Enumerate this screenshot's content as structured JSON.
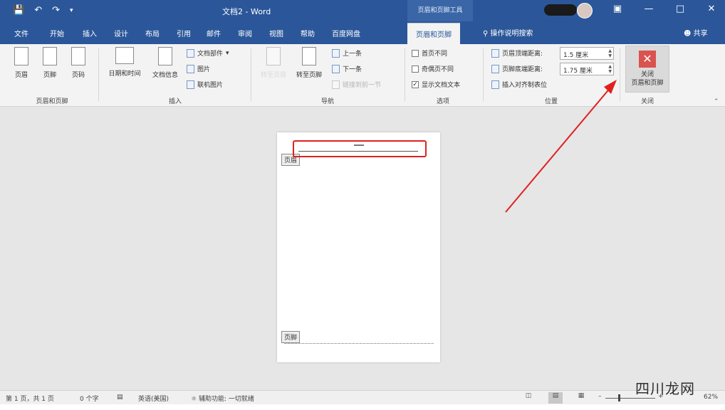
{
  "titlebar": {
    "document_title": "文档2 - Word",
    "context_tab_title": "页眉和页脚工具",
    "qat": {
      "save_icon": "save-icon",
      "undo_icon": "undo-icon",
      "redo_icon": "redo-icon",
      "customize_icon": "customize-qat-icon"
    },
    "window_controls": [
      "ribbon-display-options",
      "minimize",
      "maximize",
      "close"
    ]
  },
  "tabs": {
    "items": [
      "文件",
      "开始",
      "插入",
      "设计",
      "布局",
      "引用",
      "邮件",
      "审阅",
      "视图",
      "帮助",
      "百度网盘",
      "页眉和页脚"
    ],
    "active": "页眉和页脚",
    "tell_me": "操作说明搜索",
    "share": "共享"
  },
  "ribbon": {
    "group_header_footer": {
      "label": "页眉和页脚",
      "header": "页眉",
      "footer": "页脚",
      "page_number": "页码"
    },
    "group_insert": {
      "label": "插入",
      "date_time": "日期和时间",
      "doc_info": "文档信息",
      "doc_parts": "文档部件",
      "picture": "图片",
      "online_picture": "联机图片"
    },
    "group_navigation": {
      "label": "导航",
      "goto_header": "转至页眉",
      "goto_footer": "转至页脚",
      "previous": "上一条",
      "next": "下一条",
      "link_previous": "链接到前一节"
    },
    "group_options": {
      "label": "选项",
      "different_first_page": "首页不同",
      "different_odd_even": "奇偶页不同",
      "show_doc_text": "显示文档文本",
      "show_doc_text_checked": "✓"
    },
    "group_position": {
      "label": "位置",
      "header_from_top_label": "页眉顶端距离:",
      "header_from_top_value": "1.5 厘米",
      "footer_from_bottom_label": "页脚底端距离:",
      "footer_from_bottom_value": "1.75 厘米",
      "insert_alignment_tab": "插入对齐制表位"
    },
    "group_close": {
      "label": "关闭",
      "close_line1": "关闭",
      "close_line2": "页眉和页脚",
      "close_glyph": "✕"
    }
  },
  "document": {
    "header_tag": "页眉",
    "footer_tag": "页脚"
  },
  "statusbar": {
    "page": "第 1 页，共 1 页",
    "words": "0 个字",
    "language": "英语(美国)",
    "accessibility": "辅助功能: 一切就绪",
    "zoom": "62%"
  },
  "colors": {
    "brand_blue": "#2b579a",
    "annotation_red": "#e02020",
    "close_red": "#d9534f"
  },
  "watermark": {
    "text": "四川龙网"
  }
}
